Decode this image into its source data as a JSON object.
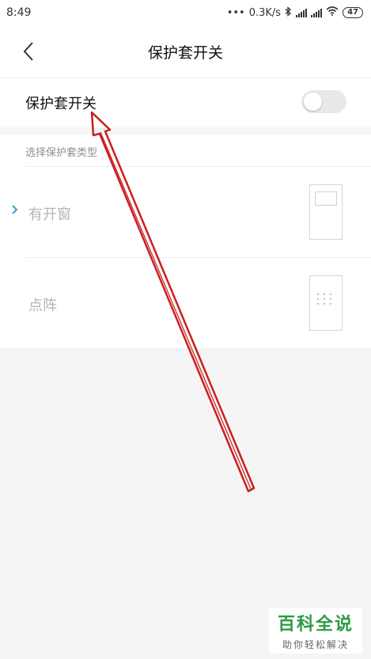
{
  "status_bar": {
    "time": "8:49",
    "network_speed": "0.3K/s",
    "battery": "47",
    "icons": [
      "dots-icon",
      "bluetooth-icon",
      "signal-icon",
      "signal-icon",
      "wifi-icon",
      "battery-icon"
    ]
  },
  "header": {
    "back_icon": "chevron-left-icon",
    "title": "保护套开关"
  },
  "switch_row": {
    "label": "保护套开关",
    "enabled": false
  },
  "case_type": {
    "section_label": "选择保护套类型",
    "options": [
      {
        "label": "有开窗",
        "selected": true,
        "preview_icon": "window-case-icon"
      },
      {
        "label": "点阵",
        "selected": false,
        "preview_icon": "dot-matrix-case-icon"
      }
    ]
  },
  "annotation": {
    "arrow_color": "#cc1f1f"
  },
  "watermark": {
    "title": "百科全说",
    "subtitle": "助你轻松解决"
  }
}
